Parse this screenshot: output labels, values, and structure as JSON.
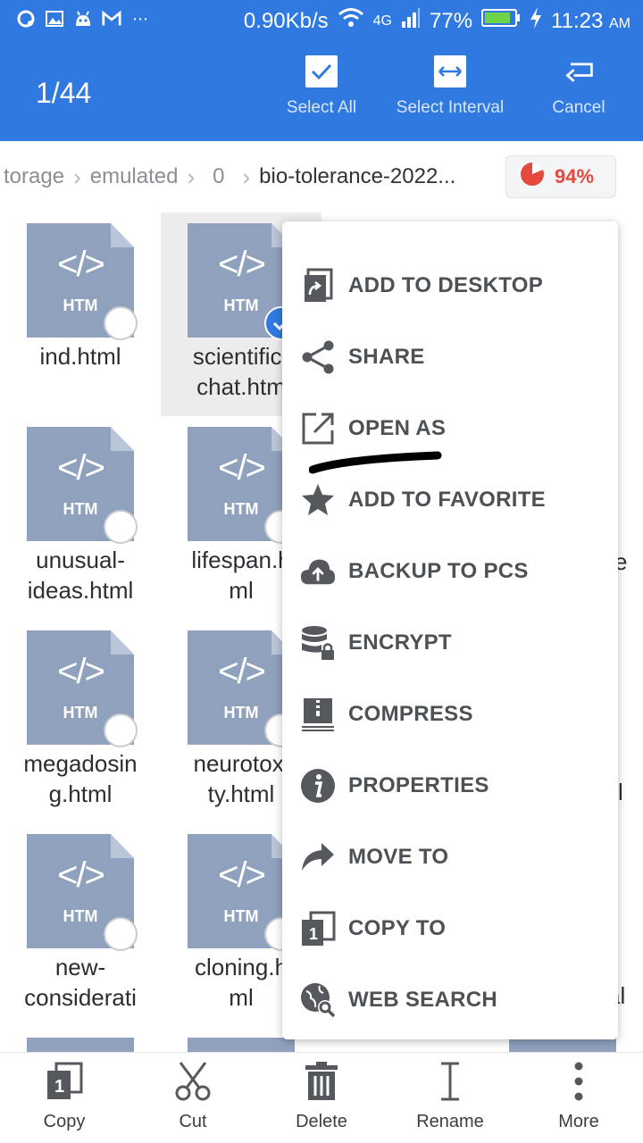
{
  "status_bar": {
    "speed": "0.90Kb/s",
    "network": "4G",
    "battery": "77%",
    "time": "11:23",
    "ampm": "AM"
  },
  "header": {
    "counter": "1/44",
    "select_all": "Select All",
    "select_interval": "Select Interval",
    "cancel": "Cancel"
  },
  "breadcrumb": {
    "items": [
      "torage",
      "emulated",
      "0",
      "bio-tolerance-2022..."
    ]
  },
  "storage_usage": "94%",
  "files": [
    {
      "name": "ind.html",
      "badge": "HTM",
      "glyph": "</>"
    },
    {
      "name": "scientific-\nchat.htm",
      "badge": "HTM",
      "glyph": "</>"
    },
    {
      "name": "unusual-\nideas.html",
      "badge": "HTM",
      "glyph": "</>"
    },
    {
      "name": "lifespan.h\nml",
      "badge": "HTM",
      "glyph": "</>"
    },
    {
      "name": "megadosin\ng.html",
      "badge": "HTM",
      "glyph": "</>"
    },
    {
      "name": "neurotoxi\nty.html",
      "badge": "HTM",
      "glyph": "</>"
    },
    {
      "name": "new-\nconsiderati",
      "badge": "HTM",
      "glyph": "</>"
    },
    {
      "name": "cloning.h\nml",
      "badge": "HTM",
      "glyph": "</>"
    }
  ],
  "partial_right_text": [
    "e",
    "l",
    "al"
  ],
  "menu": [
    {
      "label": "ADD TO DESKTOP",
      "icon": "add-to-desktop-icon"
    },
    {
      "label": "SHARE",
      "icon": "share-icon"
    },
    {
      "label": "OPEN AS",
      "icon": "open-as-icon"
    },
    {
      "label": "ADD TO FAVORITE",
      "icon": "star-icon"
    },
    {
      "label": "BACKUP TO PCS",
      "icon": "cloud-upload-icon"
    },
    {
      "label": "ENCRYPT",
      "icon": "database-lock-icon"
    },
    {
      "label": "COMPRESS",
      "icon": "zip-icon"
    },
    {
      "label": "PROPERTIES",
      "icon": "info-icon"
    },
    {
      "label": "MOVE TO",
      "icon": "move-arrow-icon"
    },
    {
      "label": "COPY TO",
      "icon": "copy-icon"
    },
    {
      "label": "WEB SEARCH",
      "icon": "globe-search-icon"
    }
  ],
  "toolbar": {
    "copy": "Copy",
    "cut": "Cut",
    "delete": "Delete",
    "rename": "Rename",
    "more": "More"
  },
  "colors": {
    "primary": "#2f79e0",
    "file_icon": "#8fa1bd",
    "usage_red": "#e5483d"
  }
}
